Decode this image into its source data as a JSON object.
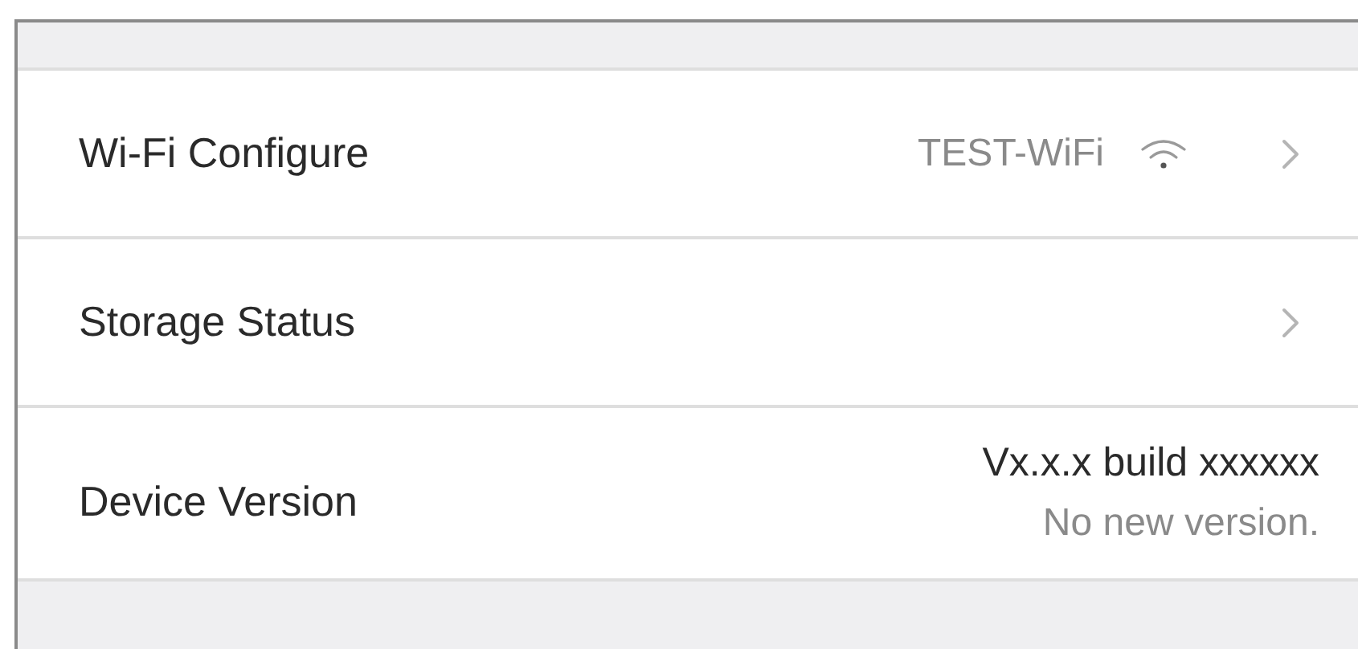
{
  "settings": [
    {
      "kind": "nav",
      "label": "Wi-Fi Configure",
      "value": "TEST-WiFi",
      "wifi": true
    },
    {
      "kind": "nav",
      "label": "Storage Status"
    },
    {
      "kind": "version",
      "label": "Device Version",
      "version": "Vx.x.x build xxxxxx",
      "status": "No new version."
    }
  ]
}
